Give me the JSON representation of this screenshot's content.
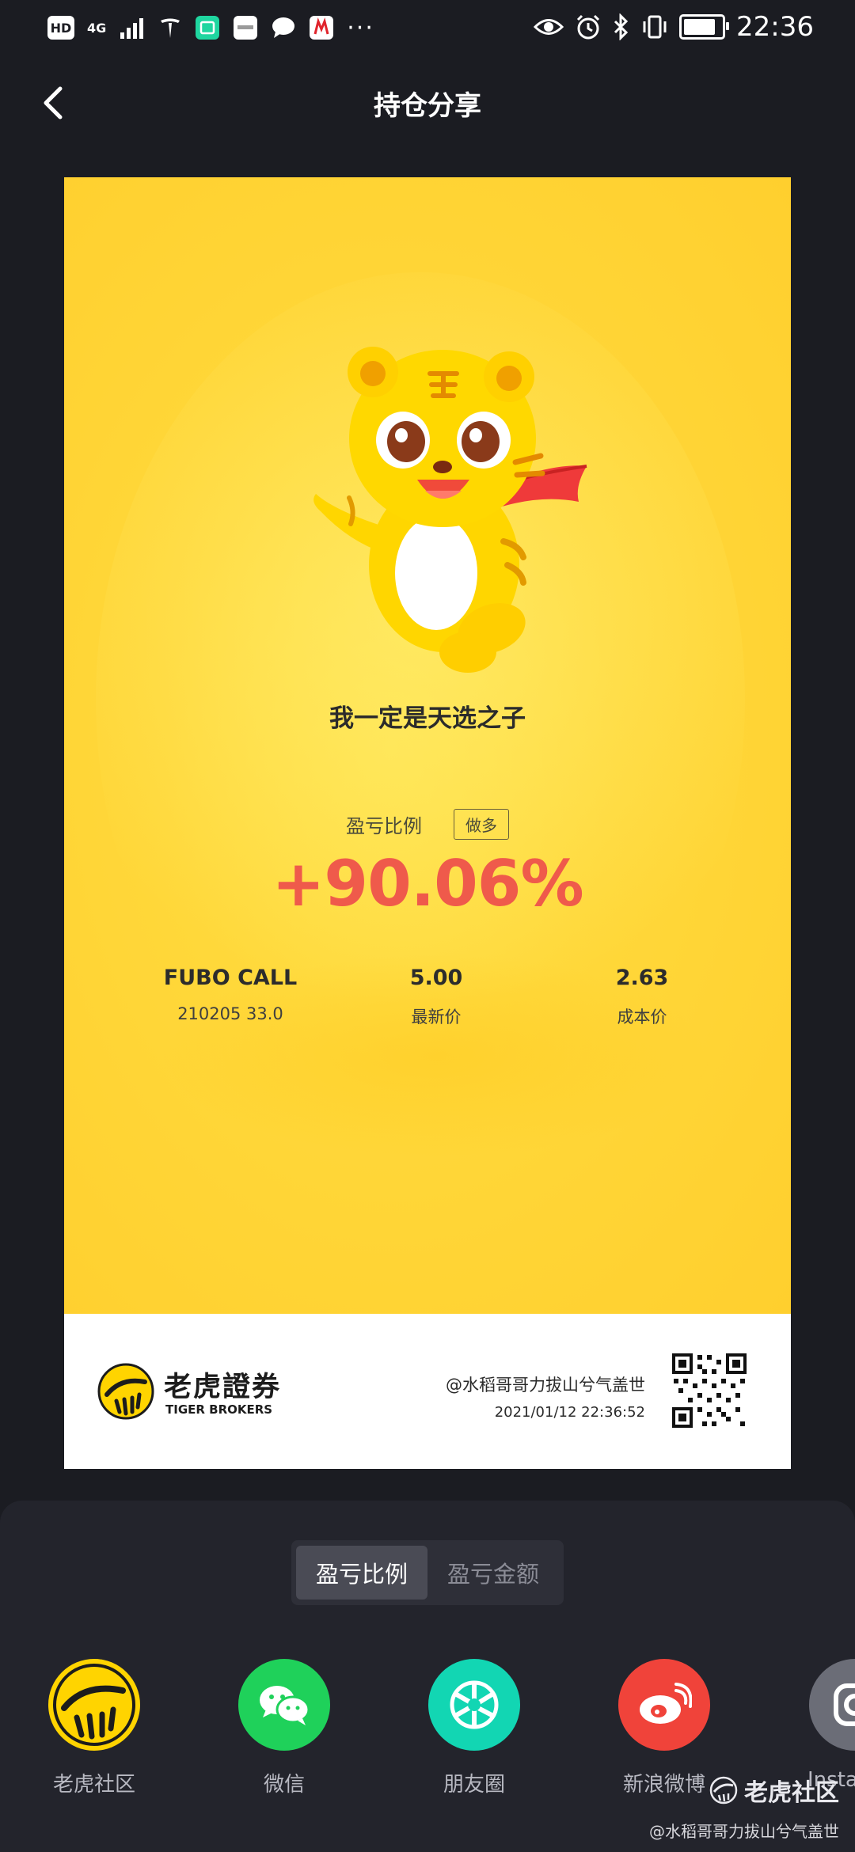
{
  "status_bar": {
    "left_badges": [
      "HD",
      "4G"
    ],
    "time": "22:36",
    "battery_level": 0.85
  },
  "nav": {
    "title": "持仓分享"
  },
  "card": {
    "slogan": "我一定是天选之子",
    "ratio_label": "盈亏比例",
    "direction_tag": "做多",
    "pnl_percent": "+90.06%",
    "stats": [
      {
        "value": "FUBO CALL",
        "sub": "210205 33.0"
      },
      {
        "value": "5.00",
        "sub": "最新价"
      },
      {
        "value": "2.63",
        "sub": "成本价"
      }
    ],
    "brand_cn": "老虎證券",
    "brand_en": "TIGER BROKERS",
    "user": "@水稻哥哥力拔山兮气盖世",
    "timestamp": "2021/01/12 22:36:52"
  },
  "sheet": {
    "segments": [
      "盈亏比例",
      "盈亏金额"
    ],
    "active_segment": 0,
    "share_targets": [
      {
        "label": "老虎社区",
        "icon": "tiger-community-icon",
        "color": "#ffd400"
      },
      {
        "label": "微信",
        "icon": "wechat-icon",
        "color": "#1fd15a"
      },
      {
        "label": "朋友圈",
        "icon": "moments-icon",
        "color": "#12d6b3"
      },
      {
        "label": "新浪微博",
        "icon": "weibo-icon",
        "color": "#f0433a"
      },
      {
        "label": "Insta",
        "icon": "instagram-icon",
        "color": "#6b6d77"
      }
    ]
  },
  "watermark": {
    "community": "老虎社区",
    "user": "@水稻哥哥力拔山兮气盖世"
  },
  "colors": {
    "page_bg": "#1b1c22",
    "card_yellow": "#ffd83a",
    "pnl_red": "#ef5a4b",
    "sheet_bg": "#23242c"
  }
}
